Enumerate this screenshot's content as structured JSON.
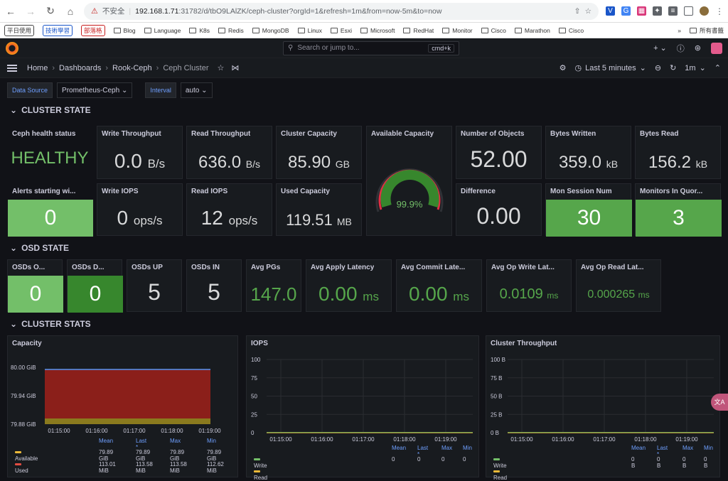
{
  "browser": {
    "insecure_label": "不安全",
    "url_host": "192.168.1.71",
    "url_rest": ":31782/d/tbO9LAlZK/ceph-cluster?orgId=1&refresh=1m&from=now-5m&to=now",
    "bookmarks_buttons": [
      "平日使用",
      "技術學習",
      "部落格"
    ],
    "bookmarks": [
      "Blog",
      "Language",
      "K8s",
      "Redis",
      "MongoDB",
      "Linux",
      "Esxi",
      "Microsoft",
      "RedHat",
      "Monitor",
      "Cisco",
      "Marathon",
      "Cisco"
    ],
    "bookmarks_overflow": "»",
    "all_bookmarks": "所有書籤"
  },
  "grafana": {
    "search_placeholder": "Search or jump to...",
    "search_shortcut": "cmd+k",
    "plus": "+ ⌄",
    "breadcrumb": [
      "Home",
      "Dashboards",
      "Rook-Ceph",
      "Ceph Cluster"
    ],
    "time_range": "Last 5 minutes",
    "refresh": "1m"
  },
  "variables": [
    {
      "label": "Data Source",
      "value": "Prometheus-Ceph"
    },
    {
      "label": "Interval",
      "value": "auto"
    }
  ],
  "rows": {
    "cluster_state": "CLUSTER STATE",
    "osd_state": "OSD STATE",
    "cluster_stats": "CLUSTER STATS"
  },
  "cluster_state": {
    "health_title": "Ceph health status",
    "health_value": "HEALTHY",
    "alerts_title": "Alerts starting wi...",
    "alerts_value": "0",
    "write_tp_title": "Write Throughput",
    "write_tp_value": "0.0",
    "write_tp_unit": "B/s",
    "read_tp_title": "Read Throughput",
    "read_tp_value": "636.0",
    "read_tp_unit": "B/s",
    "capacity_title": "Cluster Capacity",
    "capacity_value": "85.90",
    "capacity_unit": "GB",
    "avail_title": "Available Capacity",
    "avail_value": "99.9%",
    "avail_fraction": 0.999,
    "objects_title": "Number of Objects",
    "objects_value": "52.00",
    "bytes_written_title": "Bytes Written",
    "bytes_written_value": "359.0",
    "bytes_written_unit": "kB",
    "bytes_read_title": "Bytes Read",
    "bytes_read_value": "156.2",
    "bytes_read_unit": "kB",
    "write_iops_title": "Write IOPS",
    "write_iops_value": "0",
    "write_iops_unit": "ops/s",
    "read_iops_title": "Read IOPS",
    "read_iops_value": "12",
    "read_iops_unit": "ops/s",
    "used_cap_title": "Used Capacity",
    "used_cap_value": "119.51",
    "used_cap_unit": "MB",
    "difference_title": "Difference",
    "difference_value": "0.00",
    "mon_session_title": "Mon Session Num",
    "mon_session_value": "30",
    "monitors_quorum_title": "Monitors In Quor...",
    "monitors_quorum_value": "3"
  },
  "osd_state": {
    "osds_out_title": "OSDs O...",
    "osds_out_value": "0",
    "osds_down_title": "OSDs D...",
    "osds_down_value": "0",
    "osds_up_title": "OSDs UP",
    "osds_up_value": "5",
    "osds_in_title": "OSDs IN",
    "osds_in_value": "5",
    "avg_pgs_title": "Avg PGs",
    "avg_pgs_value": "147.0",
    "apply_lat_title": "Avg Apply Latency",
    "apply_lat_value": "0.00",
    "apply_lat_unit": "ms",
    "commit_lat_title": "Avg Commit Late...",
    "commit_lat_value": "0.00",
    "commit_lat_unit": "ms",
    "op_write_title": "Avg Op Write Lat...",
    "op_write_value": "0.0109",
    "op_write_unit": "ms",
    "op_read_title": "Avg Op Read Lat...",
    "op_read_value": "0.000265",
    "op_read_unit": "ms"
  },
  "chart_data": [
    {
      "type": "area",
      "title": "Capacity",
      "x": [
        "01:15:00",
        "01:16:00",
        "01:17:00",
        "01:18:00",
        "01:19:00"
      ],
      "y_ticks": [
        "80.00 GiB",
        "79.94 GiB",
        "79.88 GiB"
      ],
      "series": [
        {
          "name": "Available",
          "color": "#eab839"
        },
        {
          "name": "Used",
          "color": "#e24d42"
        }
      ],
      "legend_headers": [
        "Mean",
        "Last *",
        "Max",
        "Min"
      ],
      "legend_rows": [
        [
          "Available",
          "79.89 GiB",
          "79.89 GiB",
          "79.89 GiB",
          "79.89 GiB"
        ],
        [
          "Used",
          "113.01 MiB",
          "113.58 MiB",
          "113.58 MiB",
          "112.62 MiB"
        ]
      ]
    },
    {
      "type": "line",
      "title": "IOPS",
      "x": [
        "01:15:00",
        "01:16:00",
        "01:17:00",
        "01:18:00",
        "01:19:00"
      ],
      "y_ticks": [
        "100",
        "75",
        "50",
        "25",
        "0"
      ],
      "series": [
        {
          "name": "Write",
          "color": "#73bf69"
        },
        {
          "name": "Read",
          "color": "#eab839"
        }
      ],
      "legend_headers": [
        "Mean",
        "Last *",
        "Max",
        "Min"
      ],
      "legend_rows": [
        [
          "Write",
          "0",
          "0",
          "0",
          "0"
        ],
        [
          "Read",
          "",
          "",
          "",
          ""
        ]
      ]
    },
    {
      "type": "line",
      "title": "Cluster Throughput",
      "x": [
        "01:15:00",
        "01:16:00",
        "01:17:00",
        "01:18:00",
        "01:19:00"
      ],
      "y_ticks": [
        "100 B",
        "75 B",
        "50 B",
        "25 B",
        "0 B"
      ],
      "series": [
        {
          "name": "Write",
          "color": "#73bf69"
        },
        {
          "name": "Read",
          "color": "#eab839"
        }
      ],
      "legend_headers": [
        "Mean",
        "Last *",
        "Max",
        "Min"
      ],
      "legend_rows": [
        [
          "Write",
          "0 B",
          "0 B",
          "0 B",
          "0 B"
        ],
        [
          "Read",
          "",
          "",
          "",
          ""
        ]
      ]
    }
  ]
}
